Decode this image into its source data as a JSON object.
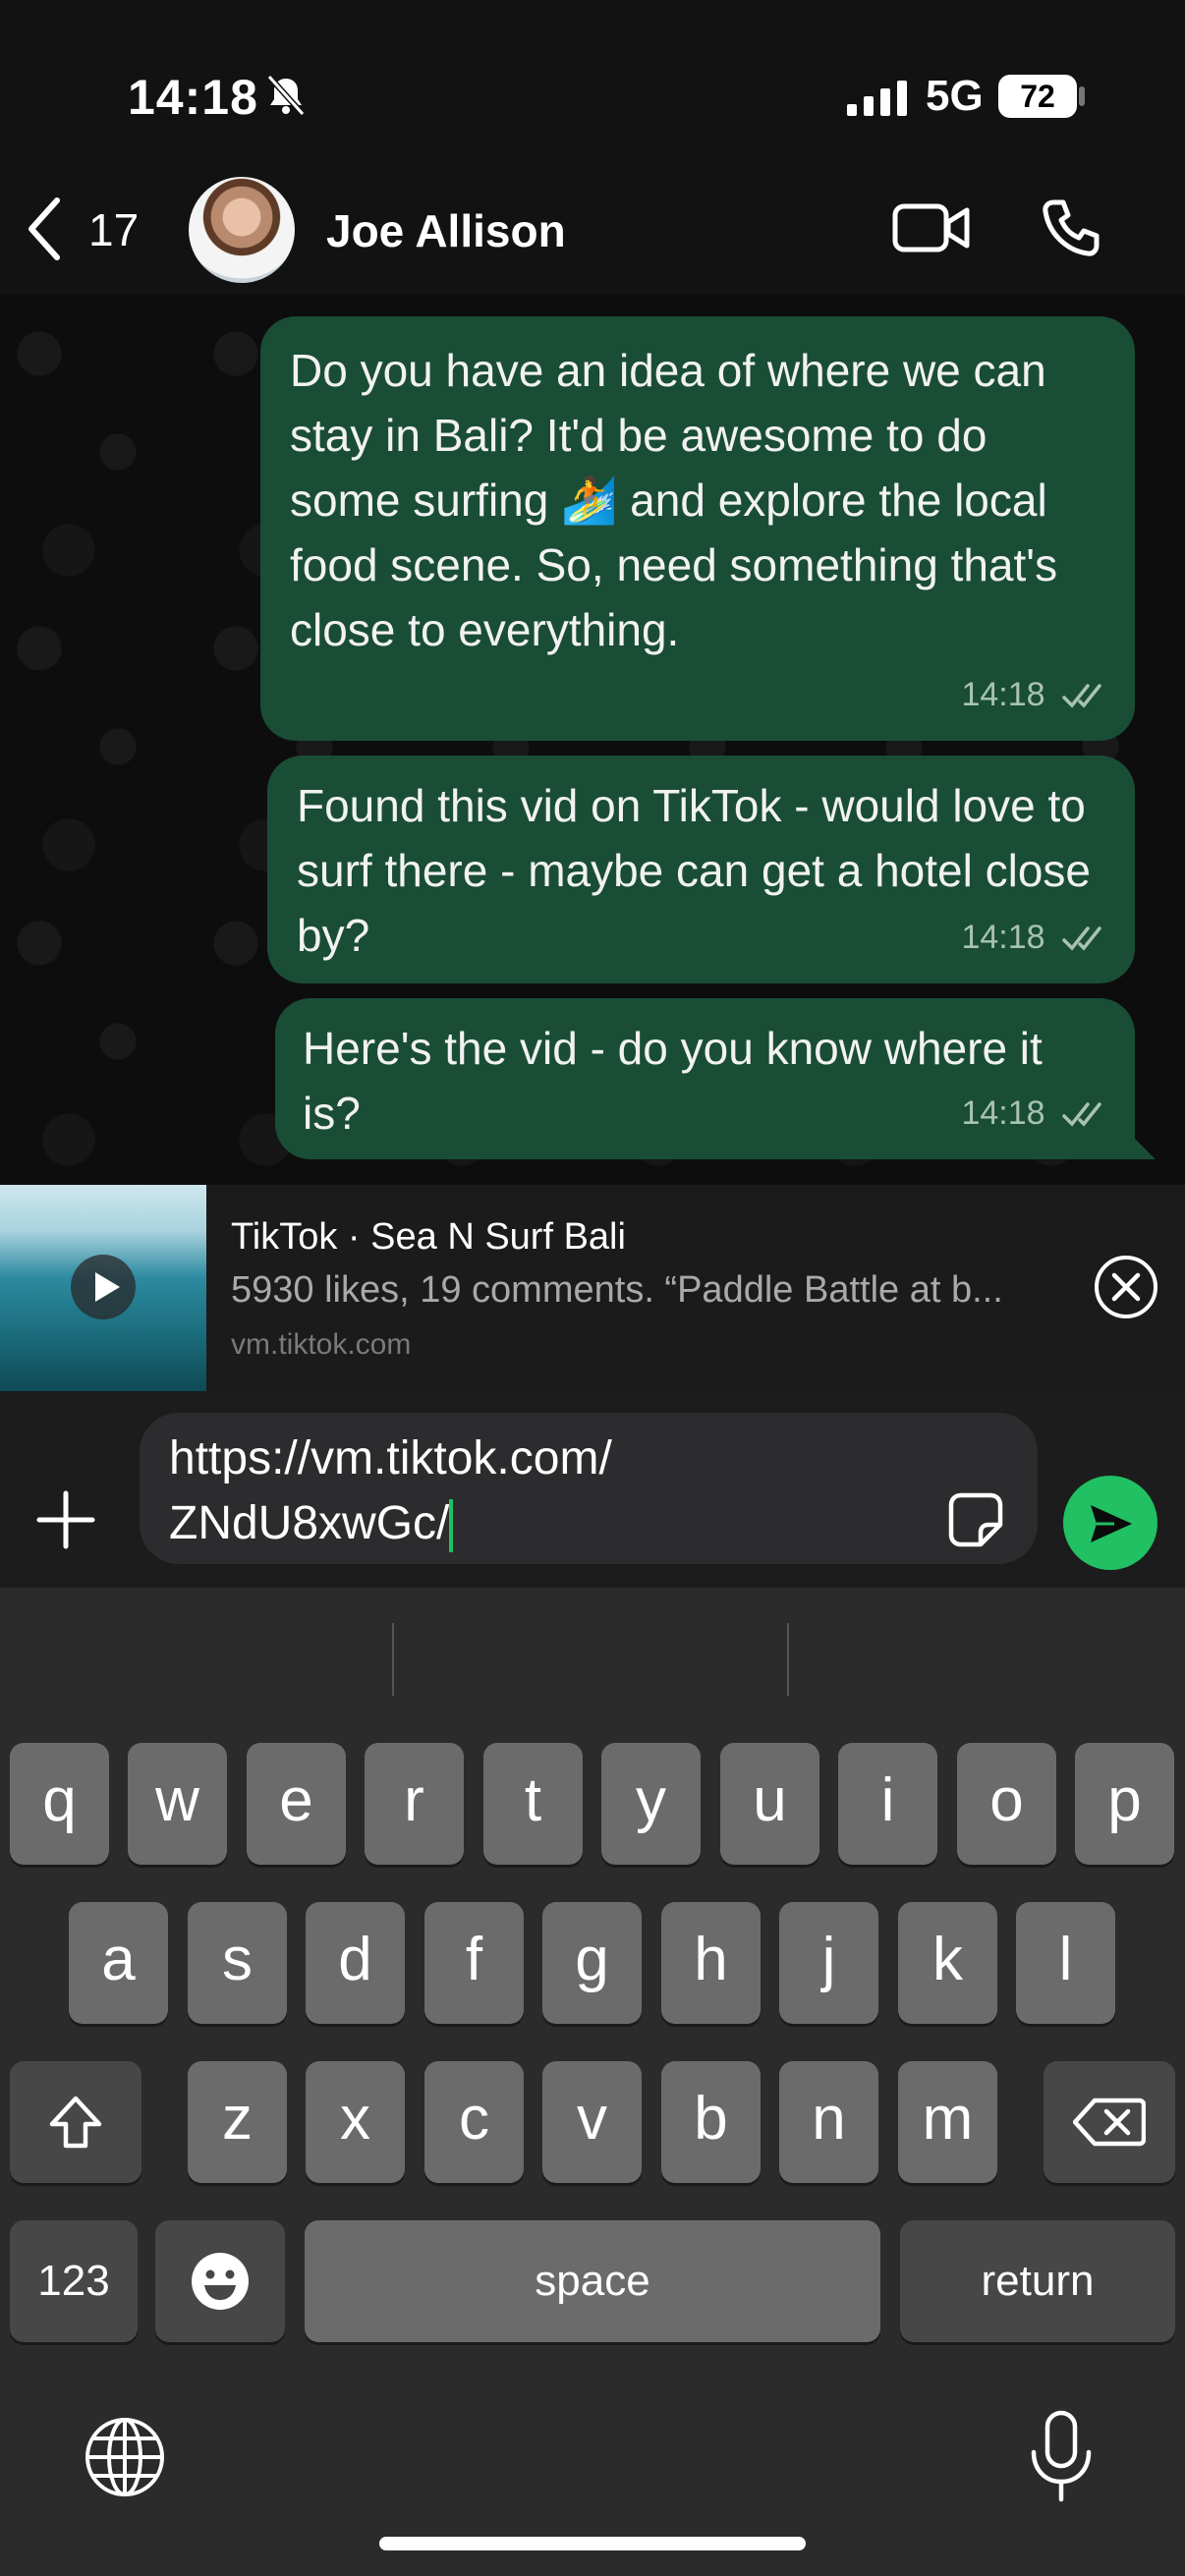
{
  "status_bar": {
    "time": "14:18",
    "network": "5G",
    "battery": "72"
  },
  "header": {
    "back_count": "17",
    "contact_name": "Joe Allison"
  },
  "messages": [
    {
      "text": "Do you have an idea of where we can stay in Bali? It'd be awesome to do some surfing 🏄 and explore the local food scene. So, need something that's close to everything.",
      "time": "14:18"
    },
    {
      "text": "Found this vid on TikTok - would love to surf there - maybe can get a hotel close by?",
      "time": "14:18"
    },
    {
      "text": "Here's the vid - do you know where it is?",
      "time": "14:18"
    }
  ],
  "link_preview": {
    "title": "TikTok · Sea N Surf Bali",
    "description": "5930 likes, 19 comments. “Paddle Battle at b...",
    "domain": "vm.tiktok.com"
  },
  "composer": {
    "line1": "https://vm.tiktok.com/",
    "line2": "ZNdU8xwGc/"
  },
  "keyboard": {
    "row1": [
      "q",
      "w",
      "e",
      "r",
      "t",
      "y",
      "u",
      "i",
      "o",
      "p"
    ],
    "row2": [
      "a",
      "s",
      "d",
      "f",
      "g",
      "h",
      "j",
      "k",
      "l"
    ],
    "row3": [
      "z",
      "x",
      "c",
      "v",
      "b",
      "n",
      "m"
    ],
    "numbers_label": "123",
    "space_label": "space",
    "return_label": "return"
  },
  "colors": {
    "accent": "#21c063",
    "bubble": "#1a4d36",
    "background": "#0d0d0d"
  }
}
